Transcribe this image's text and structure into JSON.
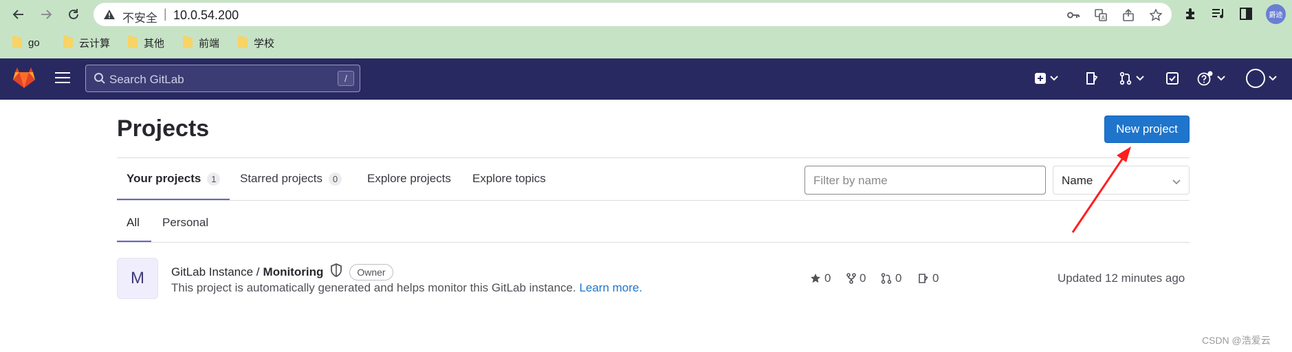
{
  "browser": {
    "security_label": "不安全",
    "separator": "|",
    "url": "10.0.54.200",
    "profile_label": "爵迹",
    "bookmarks": [
      "go",
      "云计算",
      "其他",
      "前端",
      "学校"
    ]
  },
  "header": {
    "search_placeholder": "Search GitLab",
    "search_shortcut": "/"
  },
  "page": {
    "title": "Projects",
    "new_project_label": "New project",
    "tabs": [
      {
        "label": "Your projects",
        "count": "1"
      },
      {
        "label": "Starred projects",
        "count": "0"
      },
      {
        "label": "Explore projects"
      },
      {
        "label": "Explore topics"
      }
    ],
    "filter_placeholder": "Filter by name",
    "sort_value": "Name",
    "subtabs": [
      "All",
      "Personal"
    ]
  },
  "project": {
    "avatar_letter": "M",
    "namespace": "GitLab Instance /",
    "name": "Monitoring",
    "role": "Owner",
    "description": "This project is automatically generated and helps monitor this GitLab instance.",
    "learn_more": "Learn more.",
    "stars": "0",
    "forks": "0",
    "merge_requests": "0",
    "issues": "0",
    "updated": "Updated 12 minutes ago"
  },
  "watermark": "CSDN @浩爱云"
}
